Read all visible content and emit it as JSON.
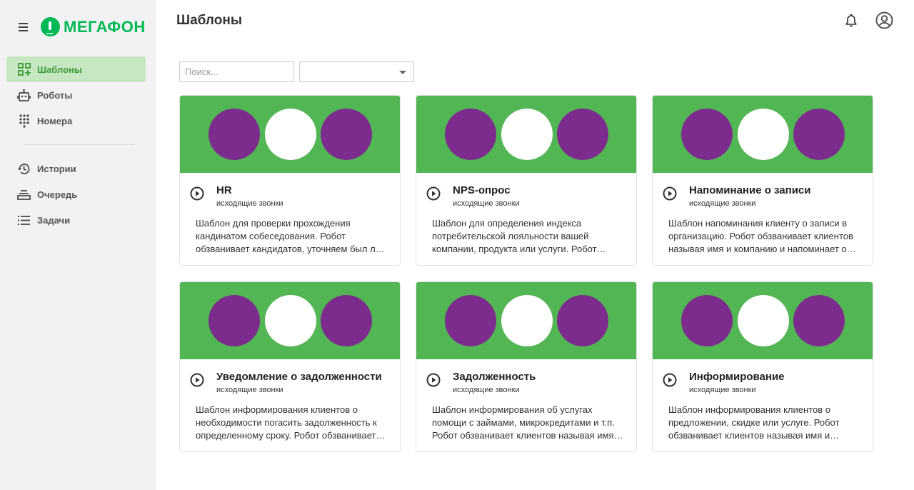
{
  "app": {
    "brand": "МегаФон",
    "page_title": "Шаблоны"
  },
  "colors": {
    "brand_green": "#00b956",
    "banner_green": "#53b654",
    "brand_purple": "#7b2c8c",
    "active_nav_bg": "#c6e7c1"
  },
  "sidebar": {
    "items": [
      {
        "label": "Шаблоны",
        "icon": "templates-grid-icon",
        "active": true
      },
      {
        "label": "Роботы",
        "icon": "robot-icon",
        "active": false
      },
      {
        "label": "Номера",
        "icon": "dialpad-icon",
        "active": false
      },
      {
        "label": "Истории",
        "icon": "history-icon",
        "active": false
      },
      {
        "label": "Очередь",
        "icon": "queue-icon",
        "active": false
      },
      {
        "label": "Задачи",
        "icon": "list-icon",
        "active": false
      }
    ]
  },
  "filters": {
    "search_placeholder": "Поиск...",
    "select_value": ""
  },
  "cards": [
    {
      "title": "HR",
      "subtitle": "исходящие звонки",
      "description": "Шаблон для проверки прохождения кандинатом собеседования. Робот обзванивает кандидатов, уточняем был ли кандидат на собеседовании."
    },
    {
      "title": "NPS-опрос",
      "subtitle": "исходящие звонки",
      "description": "Шаблон для определения индекса потребительской лояльности вашей компании, продукта или услуги. Робот обзванивает клиентов."
    },
    {
      "title": "Напоминание о записи",
      "subtitle": "исходящие звонки",
      "description": "Шаблон напоминания клиенту о записи в организацию. Робот обзванивает клиентов называя имя и компанию и напоминает о записи."
    },
    {
      "title": "Уведомление о задолженности",
      "subtitle": "исходящие звонки",
      "description": "Шаблон информирования клиентов о необходимости погасить задолженность к определенному сроку. Робот обзванивает клиентов."
    },
    {
      "title": "Задолженность",
      "subtitle": "исходящие звонки",
      "description": "Шаблон информирования об услугах помощи с займами, микрокредитами и т.п. Робот обзванивает клиентов называя имя и компанию."
    },
    {
      "title": "Информирование",
      "subtitle": "исходящие звонки",
      "description": "Шаблон информирования клиентов о предложении, скидке или услуге. Робот обзванивает клиентов называя имя и компанию."
    }
  ]
}
